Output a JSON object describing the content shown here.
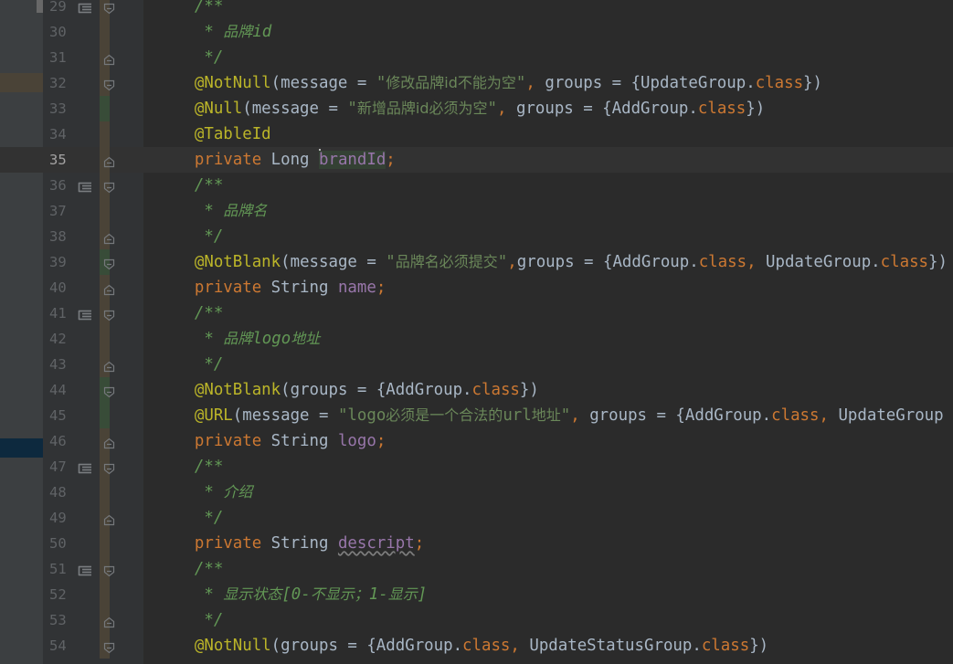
{
  "colors": {
    "background": "#2b2b2b",
    "gutter": "#313335",
    "left_panel": "#3c3f41",
    "current_line": "#323232",
    "line_number": "#606366",
    "keyword": "#cc7832",
    "annotation": "#bbb529",
    "string": "#6a8759",
    "comment": "#629755",
    "field": "#9876aa",
    "plain": "#a9b7c6"
  },
  "editor": {
    "caret_line": 35,
    "lines": [
      {
        "n": 29,
        "fold": "start",
        "icon": "doc-comment-icon",
        "vcs": "unchanged",
        "tokens": [
          {
            "t": "    /**",
            "c": "comment"
          }
        ]
      },
      {
        "n": 30,
        "fold": "none",
        "vcs": "unchanged",
        "tokens": [
          {
            "t": "     * ",
            "c": "comment"
          },
          {
            "t": "品牌",
            "c": "commentzh"
          },
          {
            "t": "id",
            "c": "comment"
          }
        ]
      },
      {
        "n": 31,
        "fold": "end",
        "vcs": "unchanged",
        "tokens": [
          {
            "t": "     */",
            "c": "comment"
          }
        ]
      },
      {
        "n": 32,
        "fold": "start",
        "vcs": "unchanged",
        "tokens": [
          {
            "t": "    @NotNull",
            "c": "annotation"
          },
          {
            "t": "(message = ",
            "c": "plain"
          },
          {
            "t": "\"",
            "c": "string"
          },
          {
            "t": "修改品牌id不能为空",
            "c": "stringzh"
          },
          {
            "t": "\"",
            "c": "string"
          },
          {
            "t": ", ",
            "c": "keyword"
          },
          {
            "t": "groups = {UpdateGroup.",
            "c": "plain"
          },
          {
            "t": "class",
            "c": "keyword"
          },
          {
            "t": "})",
            "c": "plain"
          }
        ]
      },
      {
        "n": 33,
        "fold": "none",
        "vcs": "added",
        "tokens": [
          {
            "t": "    @Null",
            "c": "annotation"
          },
          {
            "t": "(message = ",
            "c": "plain"
          },
          {
            "t": "\"",
            "c": "string"
          },
          {
            "t": "新增品牌id必须为空",
            "c": "stringzh"
          },
          {
            "t": "\"",
            "c": "string"
          },
          {
            "t": ", ",
            "c": "keyword"
          },
          {
            "t": "groups = {AddGroup.",
            "c": "plain"
          },
          {
            "t": "class",
            "c": "keyword"
          },
          {
            "t": "})",
            "c": "plain"
          }
        ]
      },
      {
        "n": 34,
        "fold": "none",
        "vcs": "unchanged",
        "tokens": [
          {
            "t": "    @TableId",
            "c": "annotation"
          }
        ]
      },
      {
        "n": 35,
        "fold": "end",
        "vcs": "current",
        "tokens": [
          {
            "t": "    private ",
            "c": "keyword"
          },
          {
            "t": "Long ",
            "c": "plain"
          },
          {
            "t": "CARET",
            "c": "caret"
          },
          {
            "t": "brandId",
            "c": "fieldref"
          },
          {
            "t": ";",
            "c": "keyword"
          }
        ]
      },
      {
        "n": 36,
        "fold": "start",
        "icon": "doc-comment-icon",
        "vcs": "unchanged",
        "tokens": [
          {
            "t": "    /**",
            "c": "comment"
          }
        ]
      },
      {
        "n": 37,
        "fold": "none",
        "vcs": "unchanged",
        "tokens": [
          {
            "t": "     * ",
            "c": "comment"
          },
          {
            "t": "品牌名",
            "c": "commentzh"
          }
        ]
      },
      {
        "n": 38,
        "fold": "end",
        "vcs": "unchanged",
        "tokens": [
          {
            "t": "     */",
            "c": "comment"
          }
        ]
      },
      {
        "n": 39,
        "fold": "start",
        "vcs": "added",
        "tokens": [
          {
            "t": "    @NotBlank",
            "c": "annotation"
          },
          {
            "t": "(message = ",
            "c": "plain"
          },
          {
            "t": "\"",
            "c": "string"
          },
          {
            "t": "品牌名必须提交",
            "c": "stringzh"
          },
          {
            "t": "\"",
            "c": "string"
          },
          {
            "t": ",",
            "c": "keyword"
          },
          {
            "t": "groups = {AddGroup.",
            "c": "plain"
          },
          {
            "t": "class",
            "c": "keyword"
          },
          {
            "t": ", ",
            "c": "keyword"
          },
          {
            "t": "UpdateGroup.",
            "c": "plain"
          },
          {
            "t": "class",
            "c": "keyword"
          },
          {
            "t": "})",
            "c": "plain"
          }
        ]
      },
      {
        "n": 40,
        "fold": "end",
        "vcs": "unchanged",
        "tokens": [
          {
            "t": "    private ",
            "c": "keyword"
          },
          {
            "t": "String ",
            "c": "plain"
          },
          {
            "t": "name",
            "c": "field"
          },
          {
            "t": ";",
            "c": "keyword"
          }
        ]
      },
      {
        "n": 41,
        "fold": "start",
        "icon": "doc-comment-icon",
        "vcs": "unchanged",
        "tokens": [
          {
            "t": "    /**",
            "c": "comment"
          }
        ]
      },
      {
        "n": 42,
        "fold": "none",
        "vcs": "unchanged",
        "tokens": [
          {
            "t": "     * ",
            "c": "comment"
          },
          {
            "t": "品牌",
            "c": "commentzh"
          },
          {
            "t": "logo",
            "c": "comment"
          },
          {
            "t": "地址",
            "c": "commentzh"
          }
        ]
      },
      {
        "n": 43,
        "fold": "end",
        "vcs": "unchanged",
        "tokens": [
          {
            "t": "     */",
            "c": "comment"
          }
        ]
      },
      {
        "n": 44,
        "fold": "start",
        "vcs": "added",
        "tokens": [
          {
            "t": "    @NotBlank",
            "c": "annotation"
          },
          {
            "t": "(groups = {AddGroup.",
            "c": "plain"
          },
          {
            "t": "class",
            "c": "keyword"
          },
          {
            "t": "})",
            "c": "plain"
          }
        ]
      },
      {
        "n": 45,
        "fold": "none",
        "vcs": "added",
        "tokens": [
          {
            "t": "    @URL",
            "c": "annotation"
          },
          {
            "t": "(message = ",
            "c": "plain"
          },
          {
            "t": "\"logo",
            "c": "string"
          },
          {
            "t": "必须是一个合法的",
            "c": "stringzh"
          },
          {
            "t": "url",
            "c": "string"
          },
          {
            "t": "地址",
            "c": "stringzh"
          },
          {
            "t": "\"",
            "c": "string"
          },
          {
            "t": ", ",
            "c": "keyword"
          },
          {
            "t": "groups = {AddGroup.",
            "c": "plain"
          },
          {
            "t": "class",
            "c": "keyword"
          },
          {
            "t": ", ",
            "c": "keyword"
          },
          {
            "t": "UpdateGroup",
            "c": "plain"
          }
        ]
      },
      {
        "n": 46,
        "fold": "end",
        "vcs": "unchanged",
        "tokens": [
          {
            "t": "    private ",
            "c": "keyword"
          },
          {
            "t": "String ",
            "c": "plain"
          },
          {
            "t": "logo",
            "c": "field"
          },
          {
            "t": ";",
            "c": "keyword"
          }
        ]
      },
      {
        "n": 47,
        "fold": "start",
        "icon": "doc-comment-icon",
        "vcs": "unchanged",
        "tokens": [
          {
            "t": "    /**",
            "c": "comment"
          }
        ]
      },
      {
        "n": 48,
        "fold": "none",
        "vcs": "unchanged",
        "tokens": [
          {
            "t": "     * ",
            "c": "comment"
          },
          {
            "t": "介绍",
            "c": "commentzh"
          }
        ]
      },
      {
        "n": 49,
        "fold": "end",
        "vcs": "unchanged",
        "tokens": [
          {
            "t": "     */",
            "c": "comment"
          }
        ]
      },
      {
        "n": 50,
        "fold": "none",
        "vcs": "unchanged",
        "tokens": [
          {
            "t": "    private ",
            "c": "keyword"
          },
          {
            "t": "String ",
            "c": "plain"
          },
          {
            "t": "descript",
            "c": "fieldwavy"
          },
          {
            "t": ";",
            "c": "keyword"
          }
        ]
      },
      {
        "n": 51,
        "fold": "start",
        "icon": "doc-comment-icon",
        "vcs": "unchanged",
        "tokens": [
          {
            "t": "    /**",
            "c": "comment"
          }
        ]
      },
      {
        "n": 52,
        "fold": "none",
        "vcs": "unchanged",
        "tokens": [
          {
            "t": "     * ",
            "c": "comment"
          },
          {
            "t": "显示状态",
            "c": "commentzh"
          },
          {
            "t": "[0-",
            "c": "comment"
          },
          {
            "t": "不显示；",
            "c": "commentzh"
          },
          {
            "t": "1-",
            "c": "comment"
          },
          {
            "t": "显示",
            "c": "commentzh"
          },
          {
            "t": "]",
            "c": "comment"
          }
        ]
      },
      {
        "n": 53,
        "fold": "end",
        "vcs": "unchanged",
        "tokens": [
          {
            "t": "     */",
            "c": "comment"
          }
        ]
      },
      {
        "n": 54,
        "fold": "start",
        "vcs": "unchanged",
        "tokens": [
          {
            "t": "    @NotNull",
            "c": "annotation"
          },
          {
            "t": "(groups = {AddGroup.",
            "c": "plain"
          },
          {
            "t": "class",
            "c": "keyword"
          },
          {
            "t": ", ",
            "c": "keyword"
          },
          {
            "t": "UpdateStatusGroup.",
            "c": "plain"
          },
          {
            "t": "class",
            "c": "keyword"
          },
          {
            "t": "})",
            "c": "plain"
          }
        ]
      }
    ]
  }
}
